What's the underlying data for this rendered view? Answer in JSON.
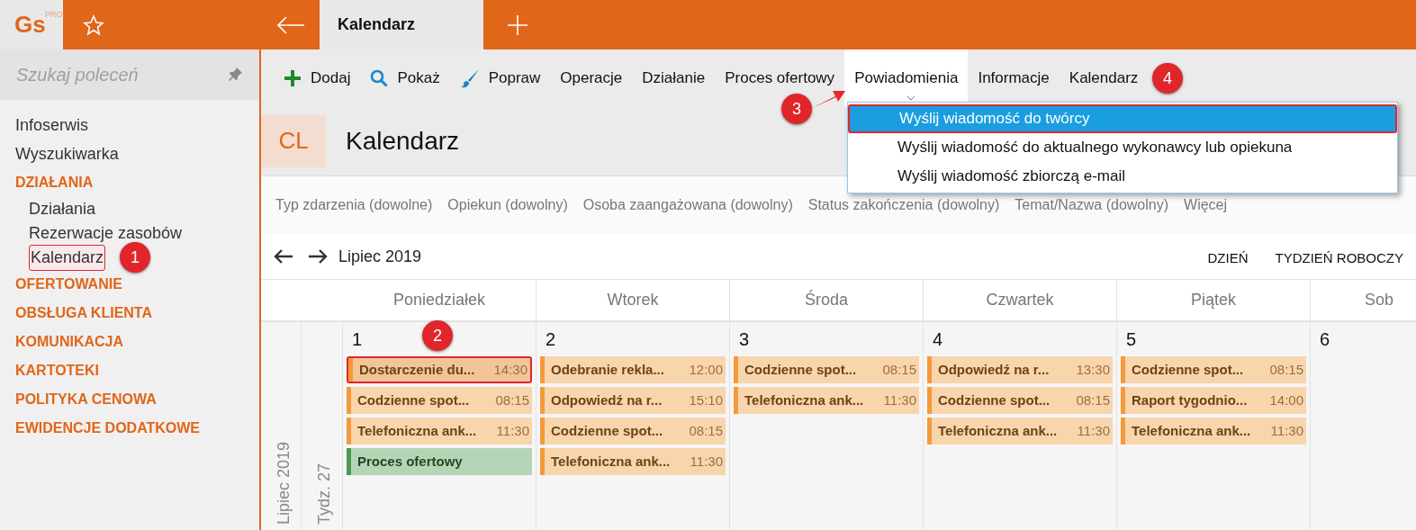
{
  "app": {
    "logo": "Gs",
    "logo_badge": "PRO"
  },
  "tabs": [
    {
      "label": "Kalendarz",
      "selected": true
    }
  ],
  "sidebar": {
    "search": {
      "placeholder": "Szukaj poleceń"
    },
    "items": [
      {
        "label": "Infoserwis",
        "kind": "link"
      },
      {
        "label": "Wyszukiwarka",
        "kind": "link"
      },
      {
        "label": "DZIAŁANIA",
        "kind": "section",
        "children": [
          {
            "label": "Działania",
            "selected": false
          },
          {
            "label": "Rezerwacje zasobów",
            "selected": false
          },
          {
            "label": "Kalendarz",
            "selected": true
          }
        ]
      },
      {
        "label": "OFERTOWANIE",
        "kind": "section"
      },
      {
        "label": "OBSŁUGA KLIENTA",
        "kind": "section"
      },
      {
        "label": "KOMUNIKACJA",
        "kind": "section"
      },
      {
        "label": "KARTOTEKI",
        "kind": "section"
      },
      {
        "label": "POLITYKA CENOWA",
        "kind": "section"
      },
      {
        "label": "EWIDENCJE DODATKOWE",
        "kind": "section"
      }
    ]
  },
  "toolbar": [
    {
      "label": "Dodaj",
      "selected": false
    },
    {
      "label": "Pokaż",
      "selected": false
    },
    {
      "label": "Popraw",
      "selected": false
    },
    {
      "label": "Operacje",
      "selected": false
    },
    {
      "label": "Działanie",
      "selected": false
    },
    {
      "label": "Proces ofertowy",
      "selected": false
    },
    {
      "label": "Powiadomienia",
      "selected": true
    },
    {
      "label": "Informacje",
      "selected": false
    },
    {
      "label": "Kalendarz",
      "selected": false
    }
  ],
  "dropdown": [
    {
      "label": "Wyślij wiadomość do twórcy",
      "selected": true
    },
    {
      "label": "Wyślij wiadomość do aktualnego wykonawcy lub opiekuna",
      "selected": false
    },
    {
      "label": "Wyślij wiadomość zbiorczą e-mail",
      "selected": false
    }
  ],
  "header": {
    "badge": "CL",
    "title": "Kalendarz"
  },
  "filters": [
    "Typ zdarzenia (dowolne)",
    "Opiekun (dowolny)",
    "Osoba zaangażowana (dowolny)",
    "Status zakończenia (dowolny)",
    "Temat/Nazwa (dowolny)",
    "Więcej"
  ],
  "calendar": {
    "period": "Lipiec 2019",
    "views": [
      "DZIEŃ",
      "TYDZIEŃ ROBOCZY"
    ],
    "month_label": "Lipiec 2019",
    "week_label": "Tydz. 27",
    "days": [
      {
        "name": "Poniedziałek",
        "number": "1",
        "events": [
          {
            "title": "Dostarczenie du...",
            "time": "14:30",
            "kind": "task",
            "selected": true
          },
          {
            "title": "Codzienne spot...",
            "time": "08:15",
            "kind": "task",
            "selected": false
          },
          {
            "title": "Telefoniczna ank...",
            "time": "11:30",
            "kind": "task",
            "selected": false
          },
          {
            "title": "Proces ofertowy",
            "kind": "process",
            "selected": false
          }
        ]
      },
      {
        "name": "Wtorek",
        "number": "2",
        "events": [
          {
            "title": "Odebranie rekla...",
            "time": "12:00",
            "kind": "task",
            "selected": false
          },
          {
            "title": "Odpowiedź na r...",
            "time": "15:10",
            "kind": "task",
            "selected": false
          },
          {
            "title": "Codzienne spot...",
            "time": "08:15",
            "kind": "task",
            "selected": false
          },
          {
            "title": "Telefoniczna ank...",
            "time": "11:30",
            "kind": "task",
            "selected": false
          }
        ]
      },
      {
        "name": "Środa",
        "number": "3",
        "events": [
          {
            "title": "Codzienne spot...",
            "time": "08:15",
            "kind": "task",
            "selected": false
          },
          {
            "title": "Telefoniczna ank...",
            "time": "11:30",
            "kind": "task",
            "selected": false
          }
        ]
      },
      {
        "name": "Czwartek",
        "number": "4",
        "events": [
          {
            "title": "Odpowiedź na r...",
            "time": "13:30",
            "kind": "task",
            "selected": false
          },
          {
            "title": "Codzienne spot...",
            "time": "08:15",
            "kind": "task",
            "selected": false
          },
          {
            "title": "Telefoniczna ank...",
            "time": "11:30",
            "kind": "task",
            "selected": false
          }
        ]
      },
      {
        "name": "Piątek",
        "number": "5",
        "events": [
          {
            "title": "Codzienne spot...",
            "time": "08:15",
            "kind": "task",
            "selected": false
          },
          {
            "title": "Raport tygodnio...",
            "time": "14:00",
            "kind": "task",
            "selected": false
          },
          {
            "title": "Telefoniczna ank...",
            "time": "11:30",
            "kind": "task",
            "selected": false
          }
        ]
      },
      {
        "name": "Sob",
        "number": "6"
      }
    ]
  },
  "annotations": [
    "1",
    "2",
    "3",
    "4"
  ]
}
